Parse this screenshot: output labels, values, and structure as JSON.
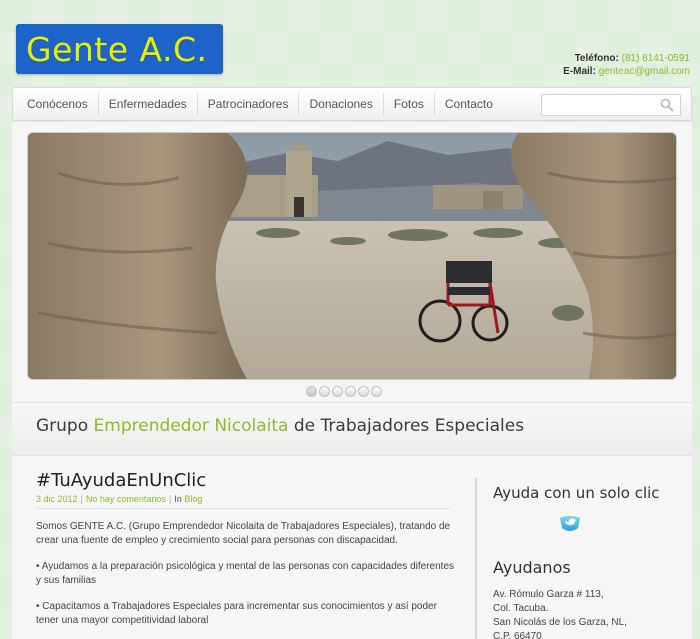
{
  "header": {
    "logo_text": "Gente A.C.",
    "phone_label": "Teléfono:",
    "phone_value": "(81) 8141-0591",
    "email_label": "E-Mail:",
    "email_value": "genteac@gmail.com"
  },
  "nav": {
    "items": [
      "Conócenos",
      "Enfermedades",
      "Patrocinadores",
      "Donaciones",
      "Fotos",
      "Contacto"
    ],
    "search_placeholder": "",
    "search_icon": "magnifier-icon"
  },
  "slider": {
    "dot_count": 6,
    "active_index": 0
  },
  "tagline": {
    "pre": "Grupo ",
    "highlight": "Emprendedor Nicolaita",
    "post": " de Trabajadores Especiales"
  },
  "post": {
    "title": "#TuAyudaEnUnClic",
    "date": "3 dic 2012",
    "comments": "No hay comentarios",
    "in_label": "In",
    "category": "Blog",
    "paragraphs": [
      "Somos GENTE A.C. (Grupo Emprendedor Nicolaita de Trabajadores Especiales), tratando de crear una fuente de empleo y crecimiento social para personas con discapacidad.",
      "• Ayudamos a la preparación psicológica y mental de las personas con capacidades diferentes y sus familias",
      "• Capacitamos a Trabajadores Especiales para incrementar sus conocimientos y así poder tener una mayor competitividad laboral"
    ]
  },
  "sidebar": {
    "heading1": "Ayuda con un solo clic",
    "icon": "twitter-icon",
    "heading2": "Ayudanos",
    "address": [
      "Av. Rómulo Garza # 113,",
      "Col. Tacuba.",
      "San Nicolás de los Garza, NL,",
      "C.P. 66470"
    ]
  },
  "colors": {
    "accent": "#8cbb2c",
    "logo_bg": "#1d63c9",
    "logo_text": "#e8f000"
  }
}
